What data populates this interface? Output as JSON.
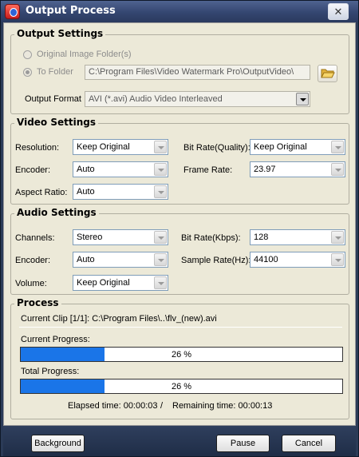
{
  "window": {
    "title": "Output Process",
    "close_glyph": "✕"
  },
  "output_settings": {
    "title": "Output Settings",
    "original_folder_label": "Original Image Folder(s)",
    "to_folder_label": "To Folder",
    "folder_path": "C:\\Program Files\\Video Watermark Pro\\OutputVideo\\",
    "output_format_label": "Output Format :",
    "output_format_value": "AVI  (*.avi) Audio Video Interleaved"
  },
  "video_settings": {
    "title": "Video Settings",
    "resolution_label": "Resolution:",
    "resolution_value": "Keep Original",
    "encoder_label": "Encoder:",
    "encoder_value": "Auto",
    "aspect_label": "Aspect Ratio:",
    "aspect_value": "Auto",
    "bitrate_label": "Bit Rate(Quality):",
    "bitrate_value": "Keep Original",
    "framerate_label": "Frame Rate:",
    "framerate_value": "23.97"
  },
  "audio_settings": {
    "title": "Audio Settings",
    "channels_label": "Channels:",
    "channels_value": "Stereo",
    "encoder_label": "Encoder:",
    "encoder_value": "Auto",
    "volume_label": "Volume:",
    "volume_value": "Keep Original",
    "bitrate_label": "Bit Rate(Kbps):",
    "bitrate_value": "128",
    "samplerate_label": "Sample Rate(Hz):",
    "samplerate_value": "44100"
  },
  "process": {
    "title": "Process",
    "current_clip": "Current Clip [1/1]: C:\\Program Files\\..\\flv_(new).avi",
    "current_progress_label": "Current Progress:",
    "current_progress_text": "26 %",
    "current_progress_value": 0.26,
    "total_progress_label": "Total Progress:",
    "total_progress_text": "26 %",
    "total_progress_value": 0.26,
    "elapsed": "Elapsed time: 00:00:03",
    "separator": "/",
    "remaining": "Remaining time: 00:00:13"
  },
  "buttons": {
    "background": "Background",
    "pause": "Pause",
    "cancel": "Cancel"
  },
  "icons": {
    "app": "app-icon",
    "folder": "folder-open-icon",
    "close": "close-icon",
    "dropdown": "chevron-down-icon"
  },
  "colors": {
    "progress_fill": "#1a75e8",
    "titlebar": "#344670"
  }
}
